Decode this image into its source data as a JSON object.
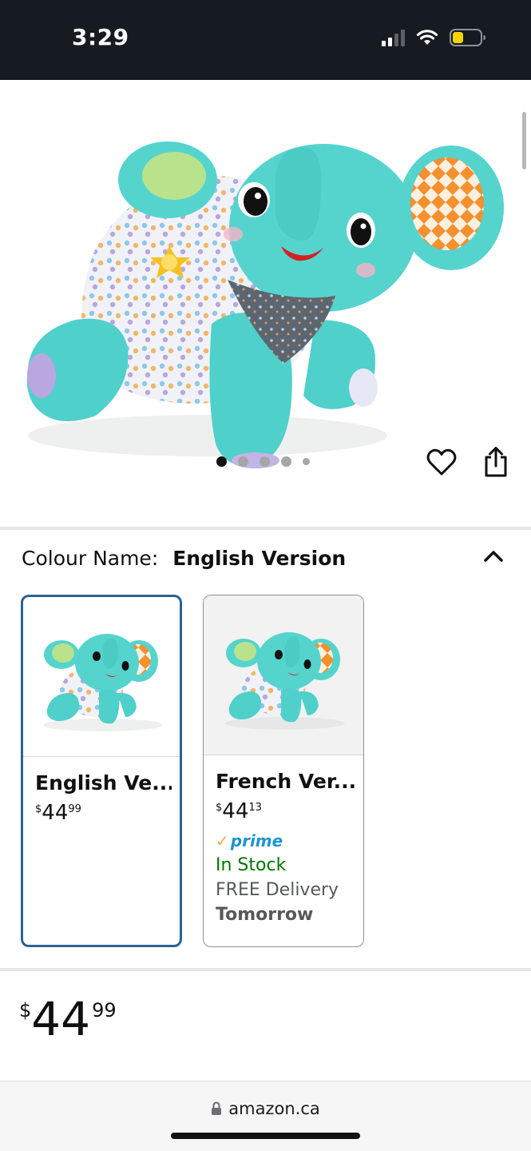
{
  "status_bar": {
    "time": "3:29"
  },
  "gallery": {
    "image_count": 5,
    "active_index": 0
  },
  "colour_selector": {
    "label": "Colour Name:",
    "selected_value": "English Version"
  },
  "options": [
    {
      "name": "English Ve...",
      "price_symbol": "$",
      "price_whole": "44",
      "price_fraction": "99",
      "selected": true
    },
    {
      "name": "French Ver...",
      "price_symbol": "$",
      "price_whole": "44",
      "price_fraction": "13",
      "prime_label": "prime",
      "stock": "In Stock",
      "delivery": "FREE Delivery",
      "delivery_day": "Tomorrow",
      "selected": false
    }
  ],
  "price": {
    "symbol": "$",
    "whole": "44",
    "fraction": "99"
  },
  "browser": {
    "url": "amazon.ca"
  },
  "colors": {
    "status_bar_bg": "#161b22",
    "selected_border": "#2a6396",
    "in_stock": "#007600",
    "prime_blue": "#1f94d2",
    "battery_yellow": "#f7d400"
  },
  "icons": [
    "signal-icon",
    "wifi-icon",
    "battery-icon",
    "heart-icon",
    "share-icon",
    "chevron-up-icon",
    "lock-icon"
  ]
}
